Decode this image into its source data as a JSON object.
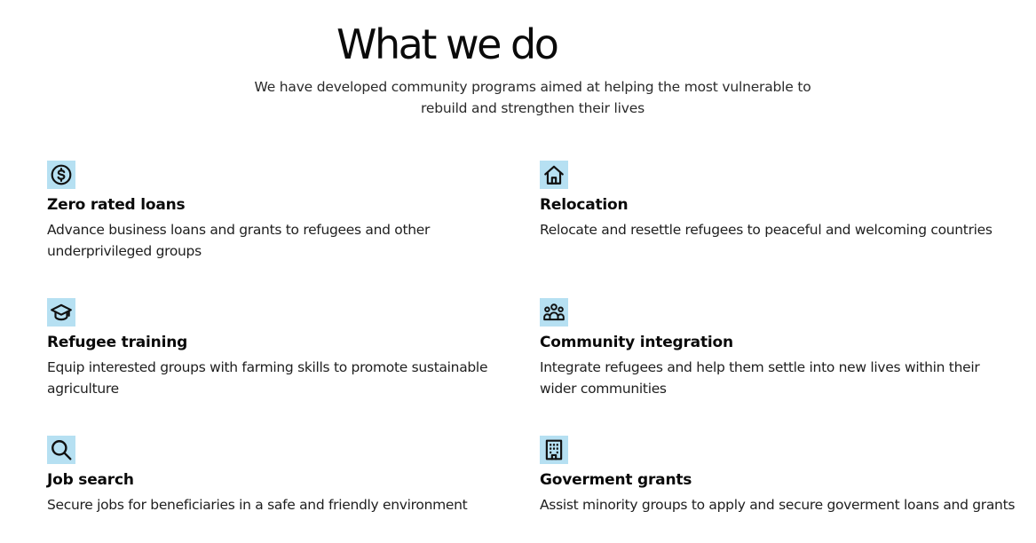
{
  "section": {
    "title": "What we do",
    "subtitle": "We have developed community programs aimed at helping the most vulnerable to rebuild and strengthen their lives"
  },
  "colors": {
    "icon_background": "#b6e0f2",
    "text": "#111111"
  },
  "features": [
    {
      "icon": "dollar-circle-icon",
      "title": "Zero rated loans",
      "description": "Advance business loans and grants to refugees and other underprivileged groups"
    },
    {
      "icon": "home-icon",
      "title": "Relocation",
      "description": "Relocate and resettle refugees to peaceful and welcoming countries"
    },
    {
      "icon": "graduation-cap-icon",
      "title": "Refugee training",
      "description": "Equip interested groups with farming skills to promote sustainable agriculture"
    },
    {
      "icon": "people-group-icon",
      "title": "Community integration",
      "description": "Integrate refugees and help them settle into new lives within their wider communities"
    },
    {
      "icon": "search-icon",
      "title": "Job search",
      "description": "Secure jobs for beneficiaries in a safe and friendly environment"
    },
    {
      "icon": "building-icon",
      "title": "Goverment grants",
      "description": "Assist minority groups to apply and secure goverment loans and grants"
    }
  ]
}
